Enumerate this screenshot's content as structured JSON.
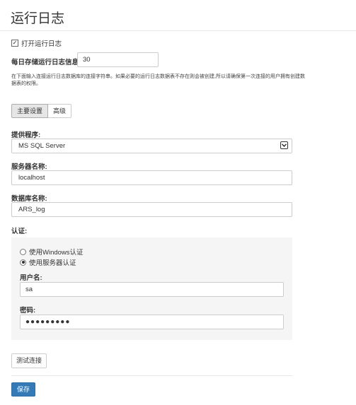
{
  "page": {
    "title": "运行日志"
  },
  "enable_log": {
    "label": "打开运行日志",
    "checked": true
  },
  "days": {
    "label": "每日存储运行日志信息:",
    "value": "30"
  },
  "help_text": "在下面输入连接运行日志数据库的连接字符串。如果必要的运行日志数据表不存在则会被创建,所以请确保第一次连接的用户拥有创建数据表的权限。",
  "tabs": [
    {
      "label": "主要设置",
      "active": true
    },
    {
      "label": "高级",
      "active": false
    }
  ],
  "provider": {
    "label": "提供程序:",
    "value": "MS SQL Server",
    "icon": "chevron-down-icon"
  },
  "server": {
    "label": "服务器名称:",
    "value": "localhost"
  },
  "database": {
    "label": "数据库名称:",
    "value": "ARS_log"
  },
  "auth": {
    "label": "认证:",
    "options": [
      {
        "label": "使用Windows认证",
        "checked": false
      },
      {
        "label": "使用服务器认证",
        "checked": true
      }
    ],
    "username": {
      "label": "用户名:",
      "value": "sa"
    },
    "password": {
      "label": "密码:",
      "value": "●●●●●●●●●"
    }
  },
  "buttons": {
    "test": "测试连接",
    "save": "保存"
  }
}
